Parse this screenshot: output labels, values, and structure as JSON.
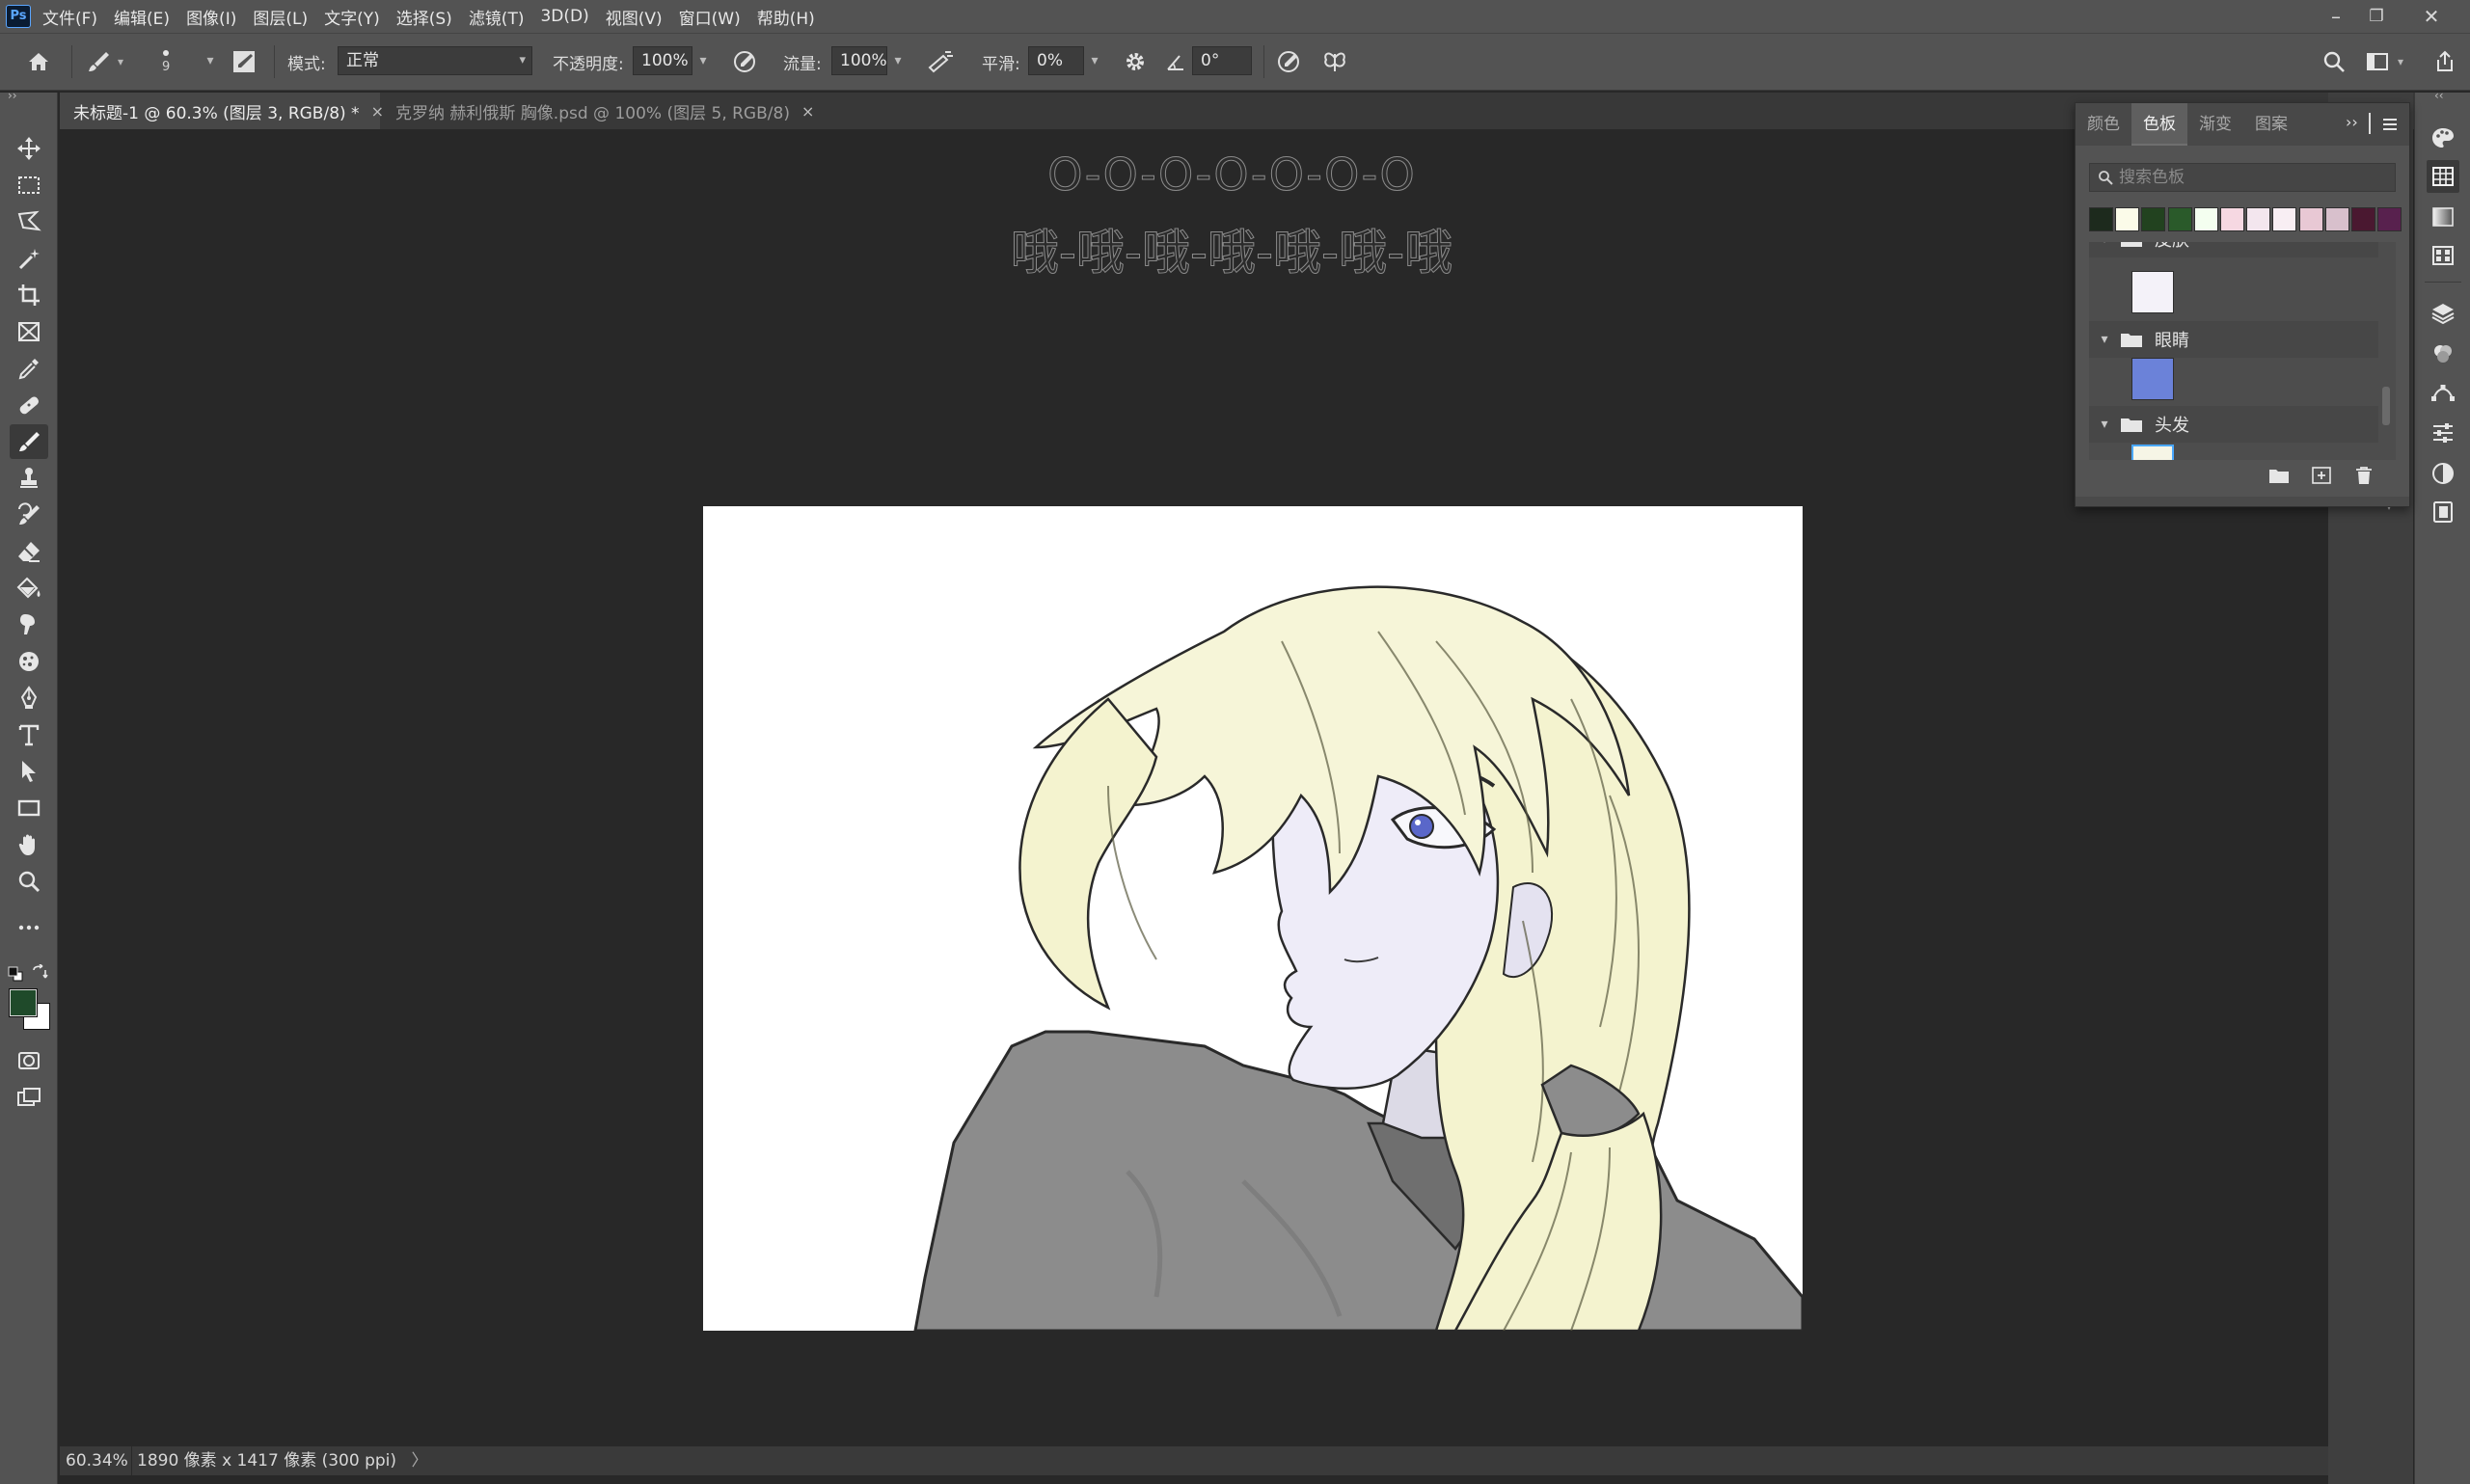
{
  "app": {
    "logo": "Ps"
  },
  "menubar": {
    "items": [
      "文件(F)",
      "编辑(E)",
      "图像(I)",
      "图层(L)",
      "文字(Y)",
      "选择(S)",
      "滤镜(T)",
      "3D(D)",
      "视图(V)",
      "窗口(W)",
      "帮助(H)"
    ],
    "window_controls": {
      "minimize": "–",
      "restore": "❐",
      "close": "✕"
    }
  },
  "options": {
    "brush_size": "9",
    "mode_label": "模式:",
    "mode_value": "正常",
    "opacity_label": "不透明度:",
    "opacity_value": "100%",
    "flow_label": "流量:",
    "flow_value": "100%",
    "smoothing_label": "平滑:",
    "smoothing_value": "0%",
    "angle_value": "0°"
  },
  "tabs": [
    {
      "label": "未标题-1 @ 60.3% (图层 3, RGB/8) *",
      "close": "×"
    },
    {
      "label": "克罗纳 赫利俄斯 胸像.psd @ 100% (图层 5, RGB/8)",
      "close": "×"
    }
  ],
  "canvas": {
    "overlay_line1": "O-O-O-O-O-O-O",
    "overlay_line2": "哦-哦-哦-哦-哦-哦-哦"
  },
  "status": {
    "zoom": "60.34%",
    "doc_info": "1890 像素 x 1417 像素 (300 ppi)",
    "arrow": "〉"
  },
  "swatches_panel": {
    "tabs": [
      "颜色",
      "色板",
      "渐变",
      "图案"
    ],
    "active_tab": "色板",
    "search_placeholder": "搜索色板",
    "recent_colors": [
      "#1d2a1d",
      "#fbfbe9",
      "#22421f",
      "#2a5a2a",
      "#f4fff0",
      "#f6d8e2",
      "#f3e6ee",
      "#f8eef3",
      "#e8c8d4",
      "#d8c0cc",
      "#4a1830",
      "#58214e"
    ],
    "groups": [
      {
        "name": "皮肤",
        "swatch": "#f4f2f9"
      },
      {
        "name": "眼睛",
        "swatch": "#6b82d9"
      },
      {
        "name": "头发",
        "swatch": "#f6f5e6"
      }
    ]
  },
  "colors": {
    "foreground": "#1f4a2a",
    "background": "#ffffff",
    "hair": "#f4f3cf",
    "shirt": "#8c8c8c",
    "skin": "#eeecf8",
    "eye": "#5a67c9"
  }
}
